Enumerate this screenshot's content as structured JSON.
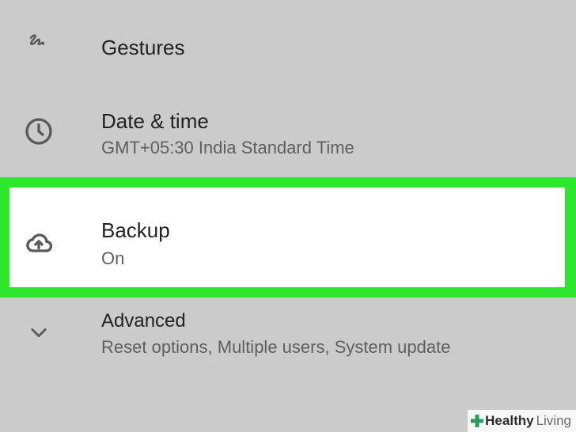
{
  "settings": {
    "items": [
      {
        "id": "gestures",
        "title": "Gestures",
        "subtitle": "",
        "icon": "gesture-icon"
      },
      {
        "id": "datetime",
        "title": "Date & time",
        "subtitle": "GMT+05:30 India Standard Time",
        "icon": "clock-icon"
      },
      {
        "id": "backup",
        "title": "Backup",
        "subtitle": "On",
        "icon": "cloud-upload-icon",
        "highlighted": true
      },
      {
        "id": "advanced",
        "title": "Advanced",
        "subtitle": "Reset options, Multiple users, System update",
        "icon": "chevron-down-icon"
      }
    ]
  },
  "watermark": {
    "main": "Healthy",
    "sub": "Living"
  },
  "colors": {
    "background": "#cbcbcb",
    "highlight": "#2ee62e",
    "icon": "#5a5a5a"
  }
}
